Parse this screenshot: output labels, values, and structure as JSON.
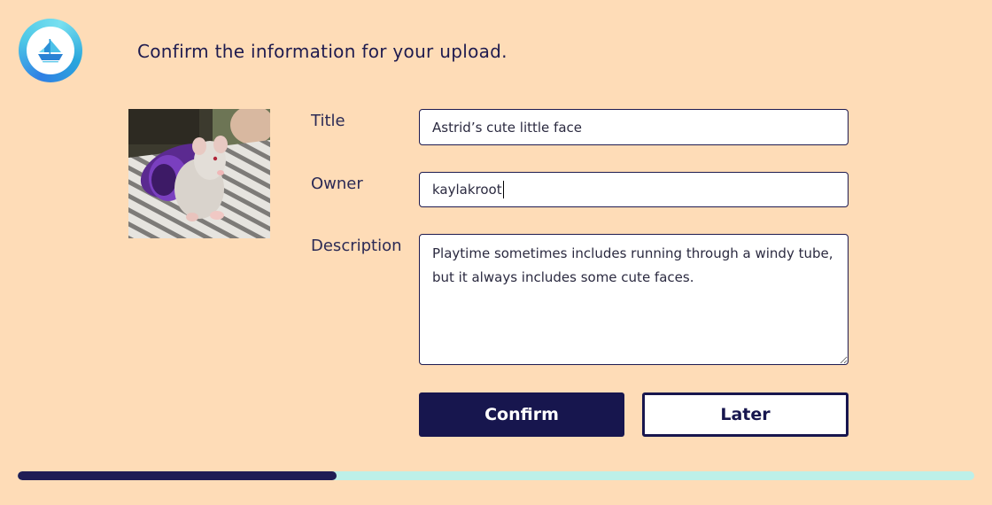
{
  "header": {
    "title": "Confirm the information for your upload.",
    "logo_icon": "ship-icon"
  },
  "form": {
    "title_label": "Title",
    "title_value": "Astrid’s cute little face",
    "owner_label": "Owner",
    "owner_value": "kaylakroot",
    "description_label": "Description",
    "description_value": "Playtime sometimes includes running through a windy tube, but it always includes some cute faces."
  },
  "buttons": {
    "confirm_label": "Confirm",
    "later_label": "Later"
  },
  "progress": {
    "fraction": 0.333
  },
  "colors": {
    "background": "#fedcb7",
    "primary": "#17164e",
    "track": "#bdf0e8"
  }
}
